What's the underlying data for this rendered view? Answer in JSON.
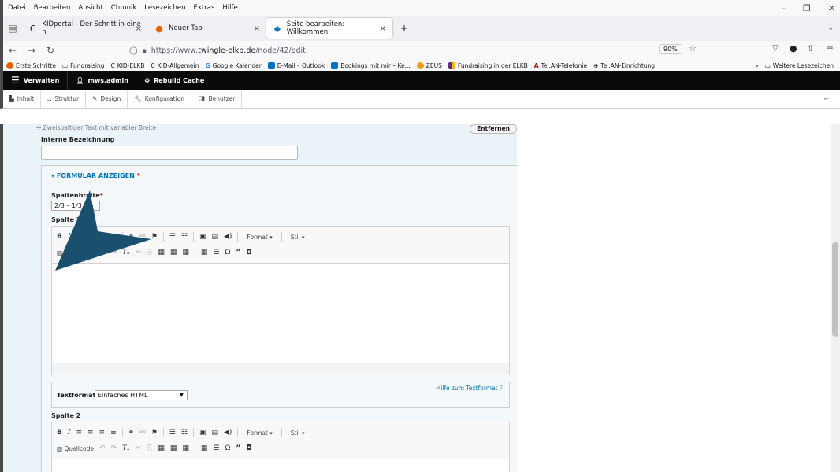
{
  "menu": [
    "Datei",
    "Bearbeiten",
    "Ansicht",
    "Chronik",
    "Lesezeichen",
    "Extras",
    "Hilfe"
  ],
  "tabs": [
    {
      "label": "KIDportal - Der Schritt in eine n",
      "close": "×"
    },
    {
      "label": "Neuer Tab",
      "close": "×"
    },
    {
      "label": "Seite bearbeiten: Willkommen",
      "close": "×"
    }
  ],
  "new_tab": "+",
  "url": {
    "prefix": "https://www.",
    "domain": "twingle-elkb.de",
    "path": "/node/42/edit"
  },
  "zoom": "90%",
  "bookmarks": [
    "Erste Schritte",
    "Fundraising",
    "KID-ELKB",
    "KID-Allgemein",
    "Google Kalender",
    "E-Mail – Outlook",
    "Bookings mit mir – Ke...",
    "ZEUS",
    "Fundraising in der ELKB",
    "Tel.AN-Telefonie",
    "Tel.AN-Einrichtung"
  ],
  "bookmarks_more": "Weitere Lesezeichen",
  "admin": {
    "manage": "Verwalten",
    "user": "mws.admin",
    "rebuild": "Rebuild Cache"
  },
  "tray": [
    "Inhalt",
    "Struktur",
    "Design",
    "Konfiguration",
    "Benutzer"
  ],
  "form": {
    "ghost_line": "Zweispaltiger Text mit variabler Breite",
    "entfernen": "Entfernen",
    "internal_label": "Interne Bezeichnung",
    "legend": "FORMULAR ANZEIGEN",
    "required_star": "*",
    "spaltenbreite_label": "Spaltenbreite",
    "spaltenbreite_value": "2/3 – 1/3",
    "spalte1": "Spalte 1",
    "spalte2": "Spalte 2",
    "format": "Format",
    "stil": "Stil",
    "quellcode": "Quellcode",
    "textformat_label": "Textformat",
    "textformat_value": "Einfaches HTML",
    "hilfe": "Hilfe zum Textformat"
  }
}
